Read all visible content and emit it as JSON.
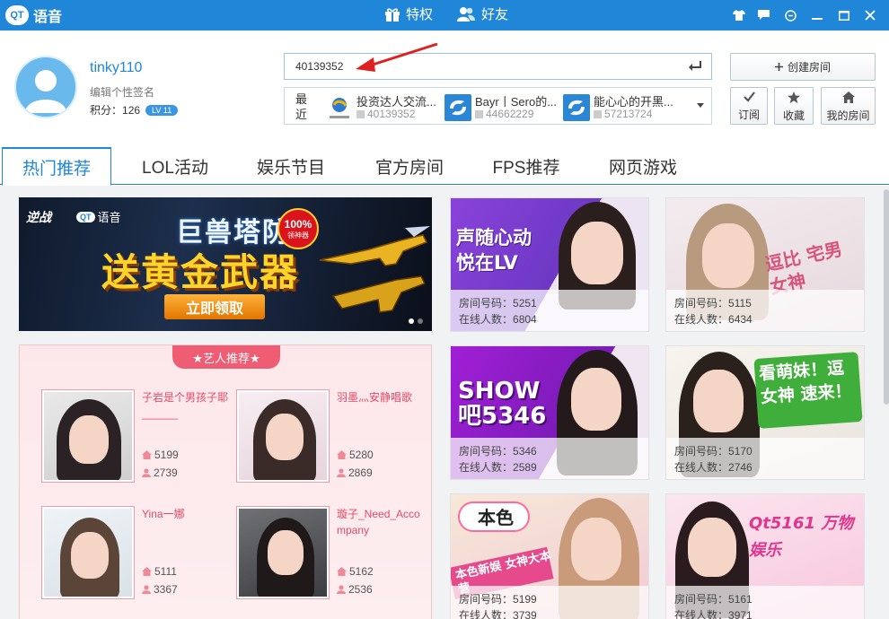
{
  "app": {
    "logo_badge": "QT",
    "logo_text": "语音",
    "nav": [
      {
        "label": "特权",
        "icon": "gift-icon"
      },
      {
        "label": "好友",
        "icon": "friends-icon"
      }
    ],
    "window_controls": [
      "shirt-icon",
      "message-icon",
      "menu-icon",
      "minimize-icon",
      "maximize-icon",
      "close-icon"
    ]
  },
  "profile": {
    "username": "tinky110",
    "signature": "编辑个性签名",
    "score_label": "积分：",
    "score": "126",
    "level": "LV 11"
  },
  "search": {
    "value": "40139352"
  },
  "recent": {
    "label": "最近",
    "items": [
      {
        "name": "投资达人交流...",
        "id": "40139352",
        "icon": "investment-logo-icon"
      },
      {
        "name": "Bayr丨Sero的...",
        "id": "44662229",
        "icon": "room-default-icon"
      },
      {
        "name": "能心心的开黑...",
        "id": "57213724",
        "icon": "room-default-icon"
      }
    ]
  },
  "actions": {
    "create_room": "创建房间",
    "subscribe": "订阅",
    "favorite": "收藏",
    "my_room": "我的房间"
  },
  "tabs": [
    "热门推荐",
    "LOL活动",
    "娱乐节目",
    "官方房间",
    "FPS推荐",
    "网页游戏"
  ],
  "banner": {
    "brand1": "逆战",
    "brand2": "语音",
    "title": "巨兽塔防",
    "headline": "送黄金武器",
    "badge_top": "100%",
    "badge_bottom": "领神器",
    "button": "立即领取"
  },
  "artists": {
    "title": "★艺人推荐★",
    "items": [
      {
        "name": "子岩是个男孩子耶______",
        "room": "5199",
        "online": "2739"
      },
      {
        "name": "羽墨灬安静唱歌",
        "room": "5280",
        "online": "2869"
      },
      {
        "name": "Yina一娜",
        "room": "5111",
        "online": "3367"
      },
      {
        "name": "璇子_Need_Accompany",
        "room": "5162",
        "online": "2536"
      }
    ]
  },
  "rooms": {
    "room_label": "房间号码：",
    "online_label": "在线人数：",
    "items": [
      {
        "room": "5251",
        "online": "6804",
        "overlay": "声随心动 悦在LV",
        "theme": "#7b3fd1"
      },
      {
        "room": "5115",
        "online": "6434",
        "overlay": "逗比 宅男女神",
        "theme": "#e8d6dc"
      },
      {
        "room": "5346",
        "online": "2589",
        "overlay": "SHOW 吧5346",
        "theme": "#9a2bd3"
      },
      {
        "room": "5170",
        "online": "2746",
        "overlay": "看萌妹！逗女神 速来！",
        "theme": "#49b33e"
      },
      {
        "room": "5199",
        "online": "3739",
        "overlay": "本色新娱 女神大本营",
        "theme": "#e64a8c"
      },
      {
        "room": "5161",
        "online": "3971",
        "overlay": "Qt5161 万物娱乐",
        "theme": "#f15fa6"
      }
    ],
    "brand_5199": "本色"
  }
}
